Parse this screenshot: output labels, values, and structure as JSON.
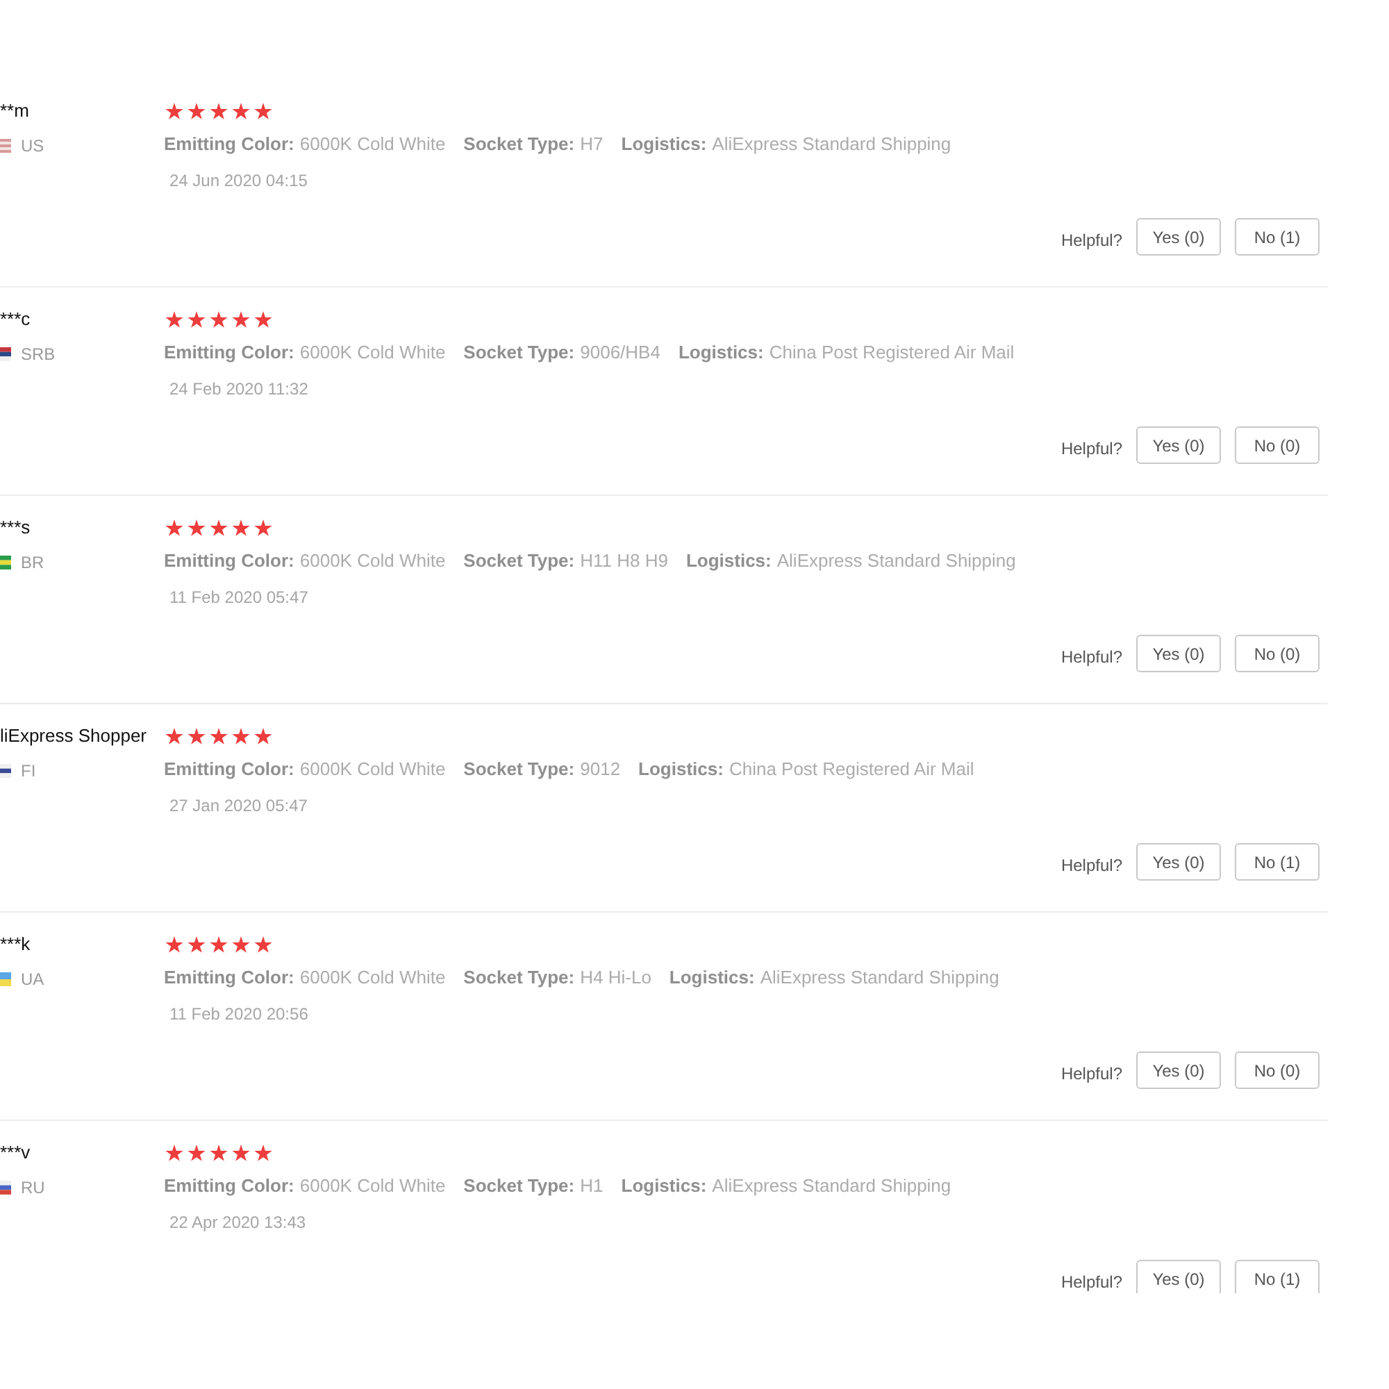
{
  "reviews": [
    {
      "name": "**m",
      "country": "US",
      "flag": [
        {
          "color": "#d99a9a"
        },
        {
          "color": "#f3e4e4"
        },
        {
          "color": "#d99a9a"
        },
        {
          "color": "#f3e4e4"
        },
        {
          "color": "#d99a9a"
        }
      ],
      "stars": 5,
      "properties": [
        {
          "label": "Emitting Color:",
          "value": "6000K Cold White"
        },
        {
          "label": "Socket Type:",
          "value": "H7"
        },
        {
          "label": "Logistics:",
          "value": "AliExpress Standard Shipping"
        }
      ],
      "date": "24 Jun 2020 04:15",
      "helpful_label": "Helpful?",
      "buttons": [
        "Yes (0)",
        "No (1)"
      ]
    },
    {
      "name": "***c",
      "country": "SRB",
      "flag": [
        {
          "color": "#c6363c"
        },
        {
          "color": "#2c4a86"
        },
        {
          "color": "#f0f0f0"
        }
      ],
      "stars": 5,
      "properties": [
        {
          "label": "Emitting Color:",
          "value": "6000K Cold White"
        },
        {
          "label": "Socket Type:",
          "value": "9006/HB4"
        },
        {
          "label": "Logistics:",
          "value": "China Post Registered Air Mail"
        }
      ],
      "date": "24 Feb 2020 11:32",
      "helpful_label": "Helpful?",
      "buttons": [
        "Yes (0)",
        "No (0)"
      ]
    },
    {
      "name": "***s",
      "country": "BR",
      "flag": [
        {
          "color": "#2a9d4a"
        },
        {
          "color": "#e8d93a"
        },
        {
          "color": "#2a9d4a"
        }
      ],
      "stars": 5,
      "properties": [
        {
          "label": "Emitting Color:",
          "value": "6000K Cold White"
        },
        {
          "label": "Socket Type:",
          "value": "H11 H8 H9"
        },
        {
          "label": "Logistics:",
          "value": "AliExpress Standard Shipping"
        }
      ],
      "date": "11 Feb 2020 05:47",
      "helpful_label": "Helpful?",
      "buttons": [
        "Yes (0)",
        "No (0)"
      ]
    },
    {
      "name": "liExpress Shopper",
      "country": "FI",
      "flag": [
        {
          "color": "#f0f0f0"
        },
        {
          "color": "#3a4a94"
        },
        {
          "color": "#f0f0f0"
        }
      ],
      "stars": 5,
      "properties": [
        {
          "label": "Emitting Color:",
          "value": "6000K Cold White"
        },
        {
          "label": "Socket Type:",
          "value": "9012"
        },
        {
          "label": "Logistics:",
          "value": "China Post Registered Air Mail"
        }
      ],
      "date": "27 Jan 2020 05:47",
      "helpful_label": "Helpful?",
      "buttons": [
        "Yes (0)",
        "No (1)"
      ]
    },
    {
      "name": "***k",
      "country": "UA",
      "flag": [
        {
          "color": "#5aa6e6"
        },
        {
          "color": "#f2d84a"
        }
      ],
      "stars": 5,
      "properties": [
        {
          "label": "Emitting Color:",
          "value": "6000K Cold White"
        },
        {
          "label": "Socket Type:",
          "value": "H4 Hi-Lo"
        },
        {
          "label": "Logistics:",
          "value": "AliExpress Standard Shipping"
        }
      ],
      "date": "11 Feb 2020 20:56",
      "helpful_label": "Helpful?",
      "buttons": [
        "Yes (0)",
        "No (0)"
      ]
    },
    {
      "name": "***v",
      "country": "RU",
      "flag": [
        {
          "color": "#f0f0f0"
        },
        {
          "color": "#4a66c8"
        },
        {
          "color": "#d9483a"
        }
      ],
      "stars": 5,
      "properties": [
        {
          "label": "Emitting Color:",
          "value": "6000K Cold White"
        },
        {
          "label": "Socket Type:",
          "value": "H1"
        },
        {
          "label": "Logistics:",
          "value": "AliExpress Standard Shipping"
        }
      ],
      "date": "22 Apr 2020 13:43",
      "helpful_label": "Helpful?",
      "buttons": [
        "Yes (0)",
        "No (1)"
      ]
    }
  ]
}
